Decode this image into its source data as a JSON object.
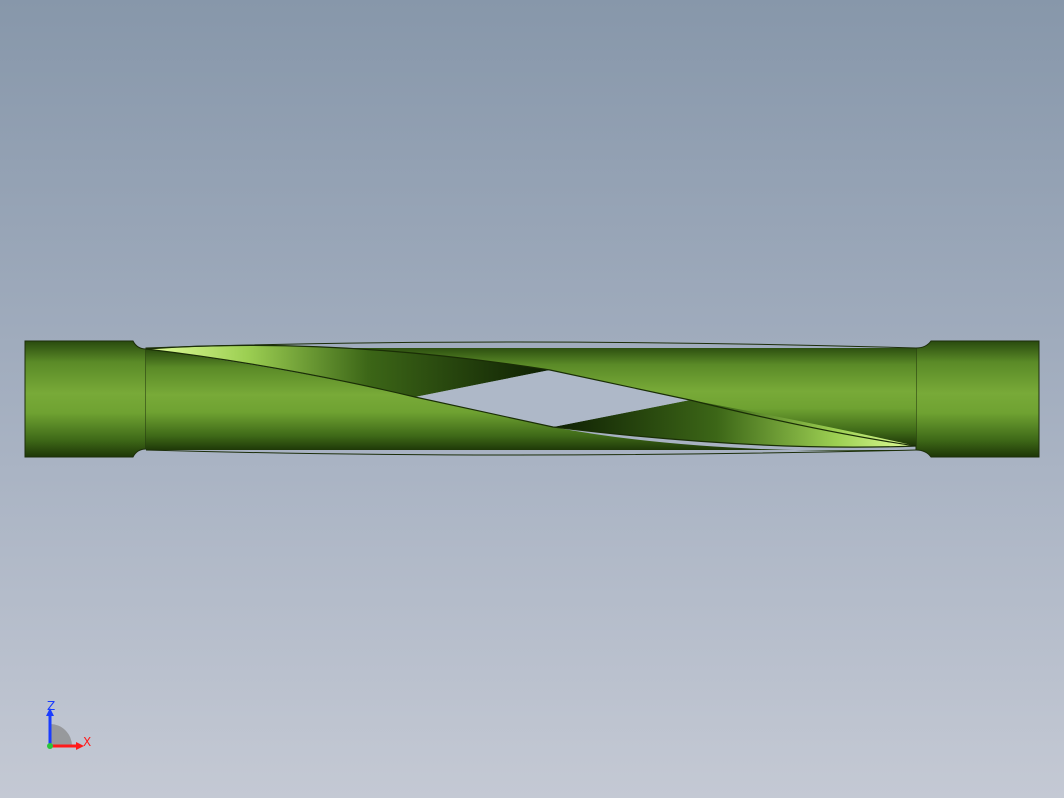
{
  "viewport": {
    "background_top": "#8797aa",
    "background_bottom": "#c4c9d4"
  },
  "model": {
    "description_icon": "twisted-drill-shaft",
    "body_color": "#76a836",
    "body_dark_color": "#1f3a08",
    "highlight_color": "#c8f07a"
  },
  "triad": {
    "z_label": "Z",
    "x_label": "X",
    "z_color": "#1a3cff",
    "x_color": "#ff1a1a"
  }
}
